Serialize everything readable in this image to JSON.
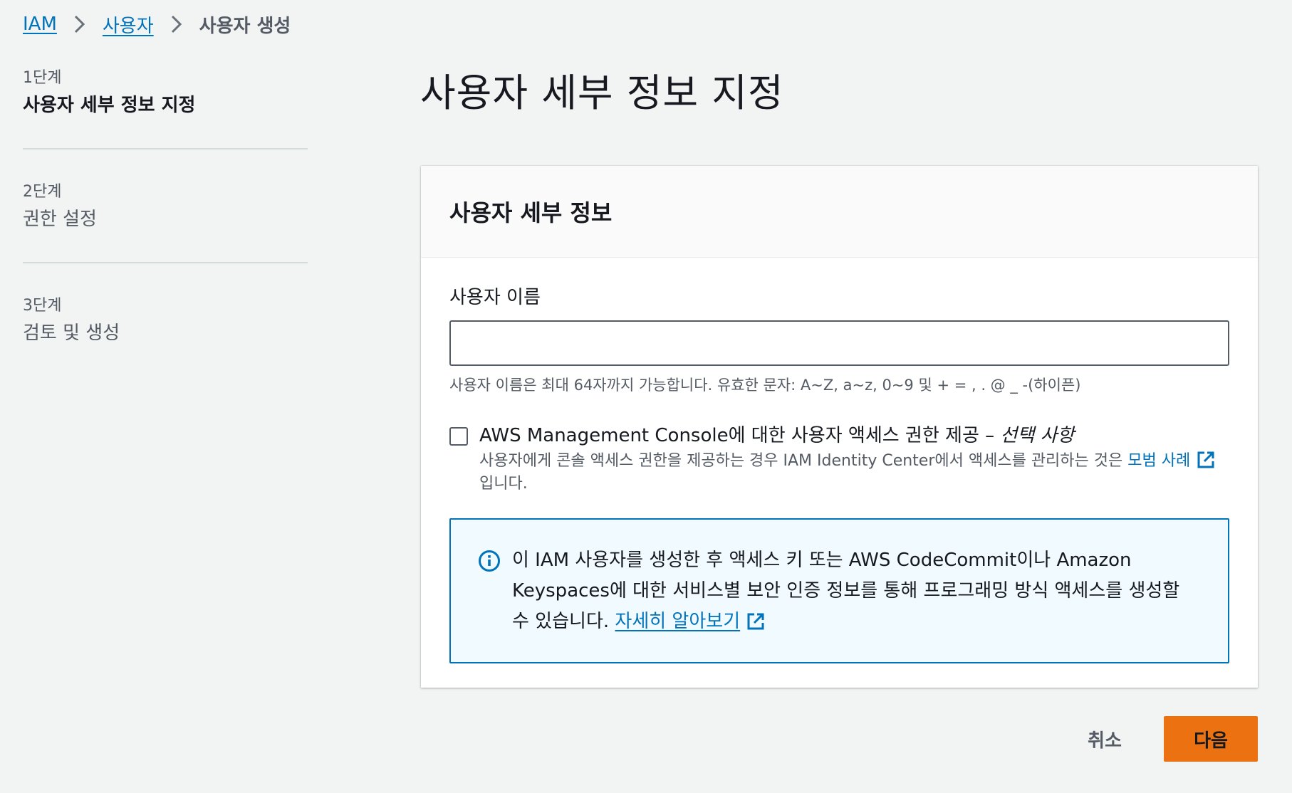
{
  "breadcrumb": {
    "items": [
      "IAM",
      "사용자"
    ],
    "current": "사용자 생성"
  },
  "steps": [
    {
      "num": "1단계",
      "title": "사용자 세부 정보 지정"
    },
    {
      "num": "2단계",
      "title": "권한 설정"
    },
    {
      "num": "3단계",
      "title": "검토 및 생성"
    }
  ],
  "page_title": "사용자 세부 정보 지정",
  "panel": {
    "header": "사용자 세부 정보",
    "username_label": "사용자 이름",
    "username_value": "",
    "username_constraint": "사용자 이름은 최대 64자까지 가능합니다. 유효한 문자: A~Z, a~z, 0~9 및 + = , . @ _ -(하이픈)",
    "console_access": {
      "label": "AWS Management Console에 대한 사용자 액세스 권한 제공 – ",
      "optional": "선택 사항",
      "desc_before": "사용자에게 콘솔 액세스 권한을 제공하는 경우 IAM Identity Center에서 액세스를 관리하는 것은 ",
      "desc_link": "모범 사례",
      "desc_after": "입니다."
    },
    "info": {
      "text": "이 IAM 사용자를 생성한 후 액세스 키 또는 AWS CodeCommit이나 Amazon Keyspaces에 대한 서비스별 보안 인증 정보를 통해 프로그래밍 방식 액세스를 생성할 수 있습니다. ",
      "link": "자세히 알아보기"
    }
  },
  "footer": {
    "cancel_label": "취소",
    "next_label": "다음"
  },
  "colors": {
    "link": "#0073bb",
    "primary_button": "#ec7211",
    "info_border": "#0073bb",
    "info_background": "#f1faff"
  }
}
